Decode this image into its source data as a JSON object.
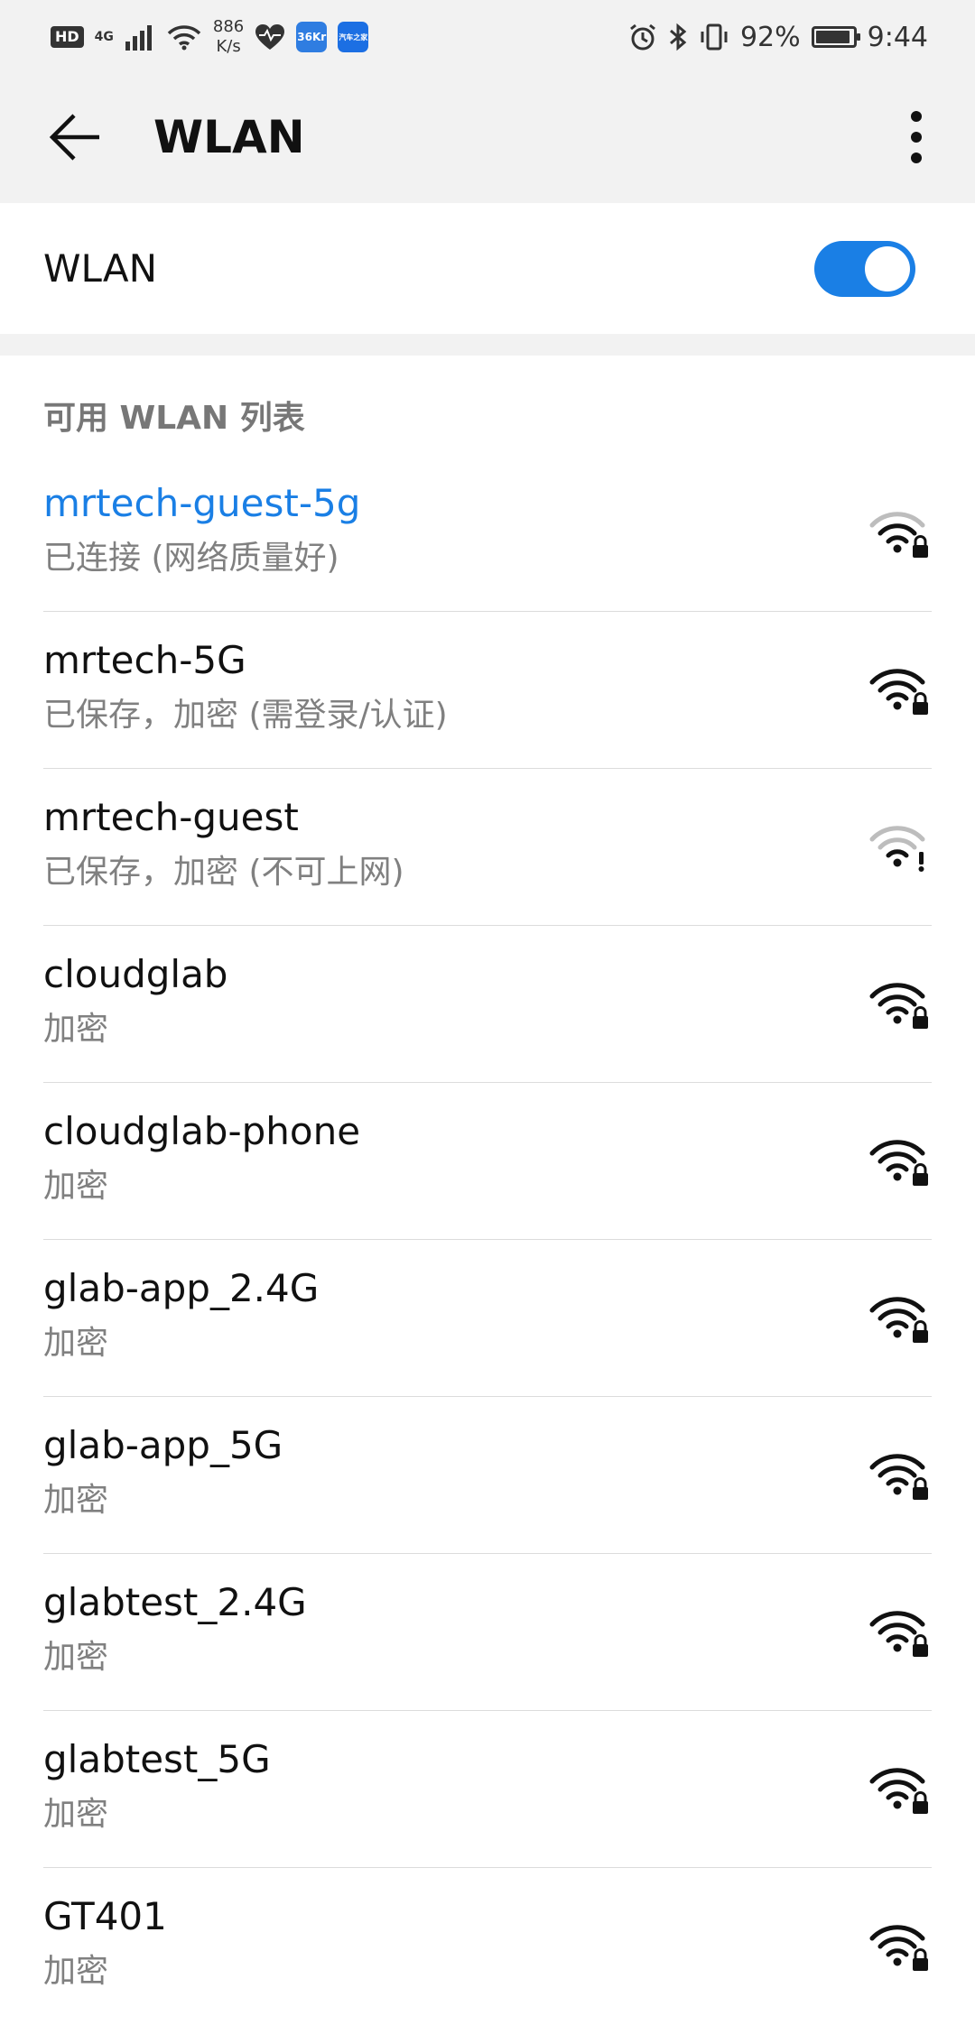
{
  "status_bar": {
    "hd": "HD",
    "network": "4G",
    "speed_value": "886",
    "speed_unit": "K/s",
    "app_chip_1": "36Kr",
    "app_chip_2": "汽车之家",
    "battery": "92%",
    "time": "9:44",
    "battery_level": 0.92
  },
  "app_bar": {
    "title": "WLAN"
  },
  "wlan_toggle": {
    "label": "WLAN",
    "enabled": true,
    "accent": "#1a7fe5"
  },
  "section": {
    "header": "可用 WLAN 列表"
  },
  "networks": [
    {
      "name": "mrtech-guest-5g",
      "status": "已连接 (网络质量好)",
      "connected": true,
      "icon": "wifi-locked-icon"
    },
    {
      "name": "mrtech-5G",
      "status": "已保存，加密 (需登录/认证)",
      "connected": false,
      "icon": "wifi-locked-icon"
    },
    {
      "name": "mrtech-guest",
      "status": "已保存，加密 (不可上网)",
      "connected": false,
      "icon": "wifi-warning-icon"
    },
    {
      "name": "cloudglab",
      "status": "加密",
      "connected": false,
      "icon": "wifi-locked-icon"
    },
    {
      "name": "cloudglab-phone",
      "status": "加密",
      "connected": false,
      "icon": "wifi-locked-icon"
    },
    {
      "name": "glab-app_2.4G",
      "status": "加密",
      "connected": false,
      "icon": "wifi-locked-icon"
    },
    {
      "name": "glab-app_5G",
      "status": "加密",
      "connected": false,
      "icon": "wifi-locked-icon"
    },
    {
      "name": "glabtest_2.4G",
      "status": "加密",
      "connected": false,
      "icon": "wifi-locked-icon"
    },
    {
      "name": "glabtest_5G",
      "status": "加密",
      "connected": false,
      "icon": "wifi-locked-icon"
    },
    {
      "name": "GT401",
      "status": "加密",
      "connected": false,
      "icon": "wifi-locked-icon"
    }
  ]
}
